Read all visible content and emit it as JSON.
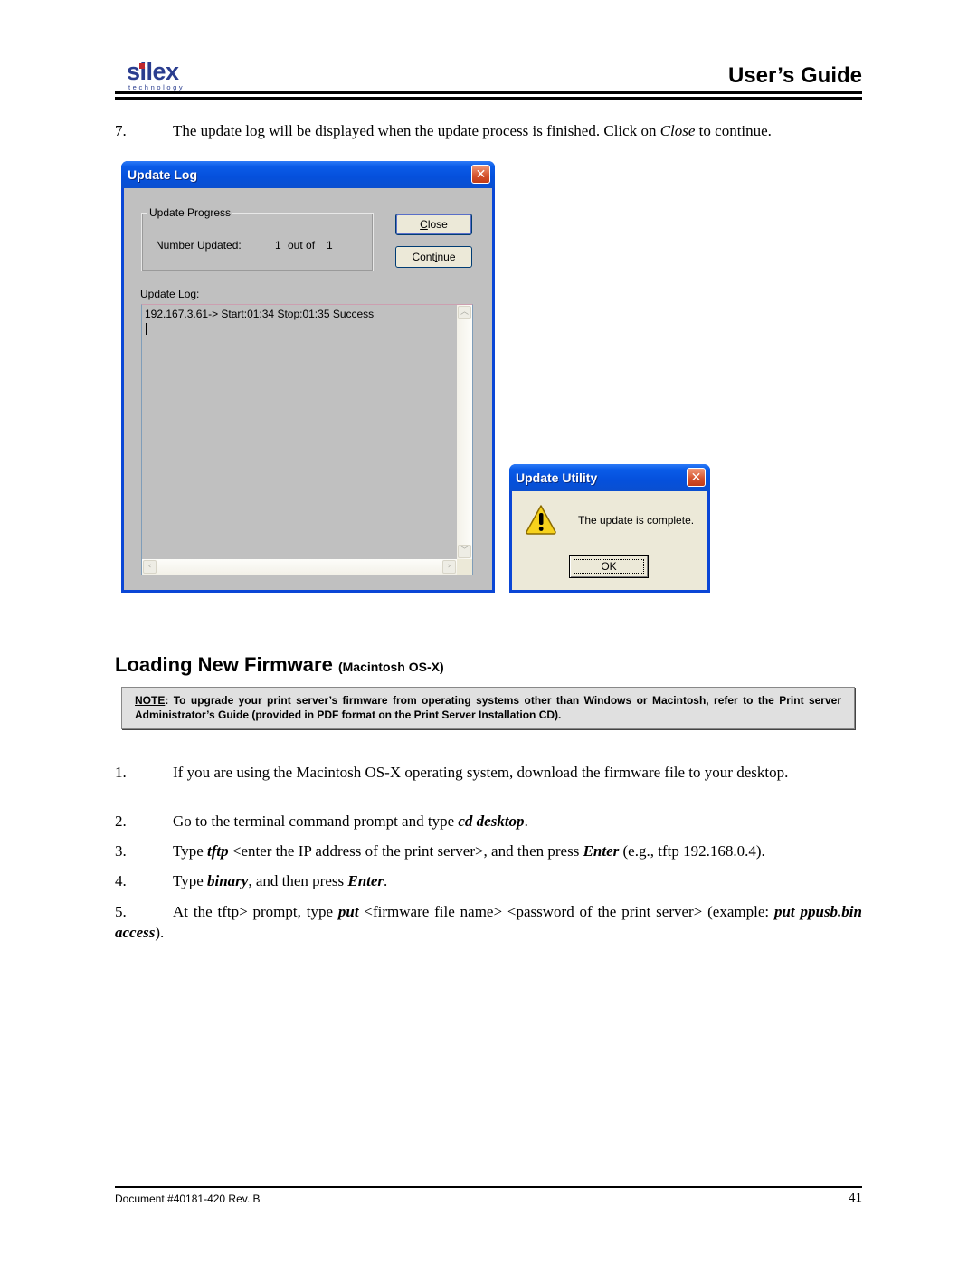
{
  "header": {
    "logo_text": "silex",
    "logo_subtext": "technology",
    "title": "User’s Guide"
  },
  "step7": {
    "number": "7.",
    "text_before": "The update log will be displayed when the update process is finished.  Click on ",
    "emphasis": "Close",
    "text_after": " to continue."
  },
  "update_log_window": {
    "title": "Update Log",
    "close_icon": "close-x-icon",
    "group_label": "Update Progress",
    "number_updated_label": "Number Updated:",
    "updated_count": "1",
    "out_of_label": "out of",
    "total_count": "1",
    "close_button": {
      "mnemonic": "C",
      "rest": "lose"
    },
    "continue_button": {
      "before": "Cont",
      "mnemonic": "i",
      "after": "nue"
    },
    "log_label": "Update Log:",
    "log_lines": [
      "192.167.3.61-> Start:01:34 Stop:01:35  Success"
    ],
    "scroll_up_icon": "chevron-up-icon",
    "scroll_down_icon": "chevron-down-icon",
    "scroll_left_icon": "chevron-left-icon",
    "scroll_right_icon": "chevron-right-icon"
  },
  "update_utility_window": {
    "title": "Update Utility",
    "icon": "warning-icon",
    "message": "The update is complete.",
    "ok_button": "OK"
  },
  "section": {
    "title": "Loading New Firmware",
    "subtitle": "(Macintosh OS-X)"
  },
  "note": {
    "label": "NOTE",
    "text": ": To upgrade your print server’s firmware from operating systems other than Windows or Macintosh, refer to the Print server Administrator’s Guide (provided in PDF format on the Print Server Installation CD)."
  },
  "steps": [
    {
      "number": "1.",
      "text": "If you are using the Macintosh OS-X operating system, download the firmware file to your desktop."
    },
    {
      "number": "2.",
      "text_before": "Go to the terminal command prompt and type ",
      "emphasis": "cd desktop",
      "text_after": "."
    },
    {
      "number": "3.",
      "text_a": "Type ",
      "em_a": "tftp",
      "text_b": " <enter the IP address of the print server>, and then press ",
      "em_b": "Enter",
      "text_c": " (e.g., tftp 192.168.0.4)."
    },
    {
      "number": "4.",
      "text_a": "Type ",
      "em_a": "binary",
      "text_b": ", and then press ",
      "em_b": "Enter",
      "text_c": "."
    },
    {
      "number": "5.",
      "text_a": "At the tftp> prompt, type ",
      "em_a": "put",
      "text_b": " <firmware file name> <password of the print server> (example: ",
      "em_b": "put ppusb.bin access",
      "text_c": ")."
    }
  ],
  "footer": {
    "document": "Document #40181-420  Rev. B",
    "page_number": "41"
  }
}
